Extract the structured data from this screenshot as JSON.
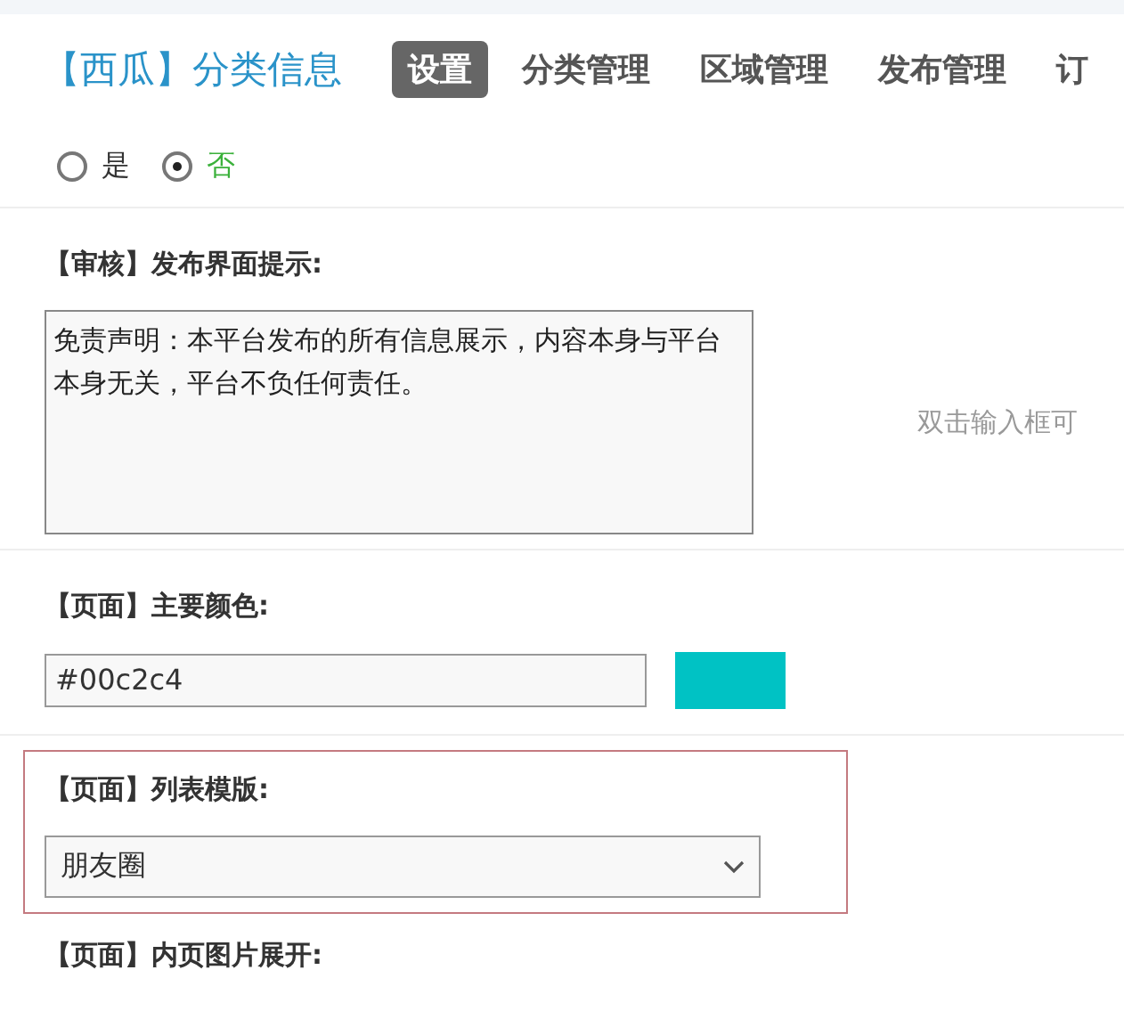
{
  "brand": "【西瓜】分类信息",
  "nav": [
    {
      "label": "设置",
      "selected": true
    },
    {
      "label": "分类管理",
      "selected": false
    },
    {
      "label": "区域管理",
      "selected": false
    },
    {
      "label": "发布管理",
      "selected": false
    },
    {
      "label": "订",
      "selected": false
    }
  ],
  "radio": [
    {
      "label": "是",
      "selected": false
    },
    {
      "label": "否",
      "selected": true
    }
  ],
  "review_tip": {
    "label": "【审核】发布界面提示:",
    "value": "免责声明：本平台发布的所有信息展示，内容本身与平台本身无关，平台不负任何责任。",
    "hint": "双击输入框可"
  },
  "main_color": {
    "label": "【页面】主要颜色:",
    "value": "#00c2c4",
    "swatch": {
      "color": "#00c2c4"
    }
  },
  "list_template": {
    "label": "【页面】列表模版:",
    "value": "朋友圈",
    "highlighted": true
  },
  "next_label": "【页面】内页图片展开:"
}
